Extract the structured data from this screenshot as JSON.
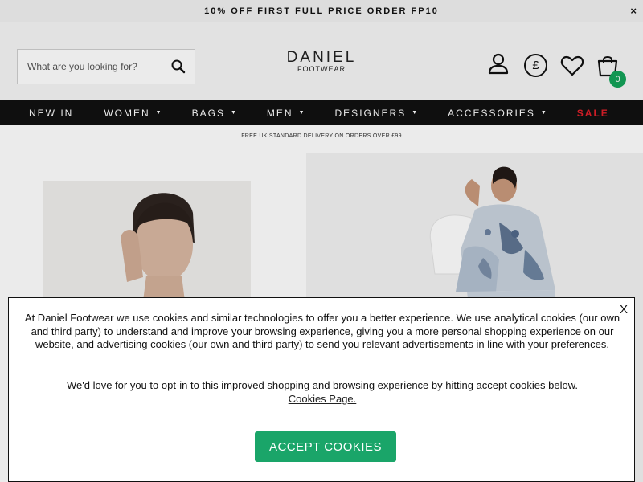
{
  "promo": {
    "text": "10% OFF FIRST FULL PRICE ORDER FP10",
    "close": "×"
  },
  "search": {
    "placeholder": "What are you looking for?"
  },
  "logo": {
    "main": "DANIEL",
    "sub": "FOOTWEAR"
  },
  "header_icons": {
    "account": "user-icon",
    "currency": "£",
    "wishlist": "heart-icon",
    "bag": "shopping-bag-icon",
    "bag_count": "0"
  },
  "nav": {
    "items": [
      {
        "label": "NEW IN",
        "caret": ""
      },
      {
        "label": "WOMEN",
        "caret": "▼"
      },
      {
        "label": "BAGS",
        "caret": "▼"
      },
      {
        "label": "MEN",
        "caret": "▼"
      },
      {
        "label": "DESIGNERS",
        "caret": "▼"
      },
      {
        "label": "ACCESSORIES",
        "caret": "▼"
      },
      {
        "label": "SALE",
        "caret": ""
      }
    ]
  },
  "delivery": "FREE UK STANDARD DELIVERY ON ORDERS OVER £99",
  "cookie": {
    "close": "X",
    "paragraph1": "At Daniel Footwear we use cookies and similar technologies to offer you a better experience. We use analytical cookies (our own and third party) to understand and improve your browsing experience, giving you a more personal shopping experience on our website, and advertising cookies (our own and third party) to send you relevant advertisements in line with your preferences.",
    "paragraph2": "We'd love for you to opt-in to this improved shopping and browsing experience by hitting accept cookies below.",
    "link": "Cookies Page.",
    "accept_label": "ACCEPT COOKIES"
  },
  "colors": {
    "nav_bg": "#111111",
    "sale": "#e0202a",
    "accept": "#1aa569",
    "bag_badge": "#14a35a"
  }
}
